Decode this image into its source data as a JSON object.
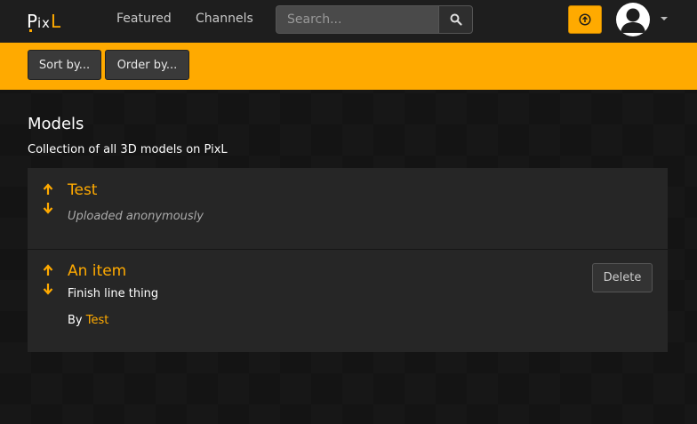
{
  "brand": {
    "name": "PixL",
    "accent": "#ffaa00"
  },
  "nav": {
    "featured": "Featured",
    "channels": "Channels"
  },
  "search": {
    "placeholder": "Search...",
    "icon": "search-icon"
  },
  "header": {
    "upload_icon": "upload-icon",
    "avatar_icon": "user-avatar-icon",
    "menu_caret": "chevron-down-icon"
  },
  "toolbar": {
    "sort_label": "Sort by...",
    "order_label": "Order by..."
  },
  "page": {
    "title": "Models",
    "description": "Collection of all 3D models on PixL"
  },
  "items": [
    {
      "title": "Test",
      "subtitle": "Uploaded anonymously"
    },
    {
      "title": "An item",
      "description": "Finish line thing",
      "by_prefix": "By",
      "by_author": "Test",
      "delete_label": "Delete"
    }
  ]
}
